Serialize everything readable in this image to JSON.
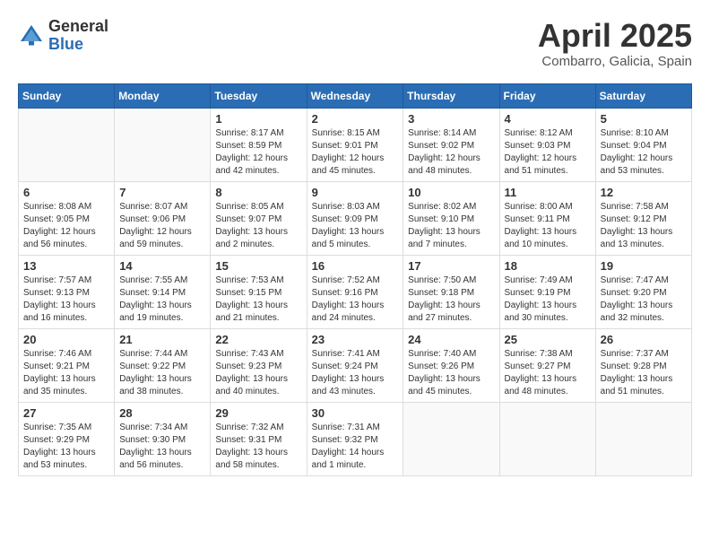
{
  "header": {
    "logo_general": "General",
    "logo_blue": "Blue",
    "month_title": "April 2025",
    "location": "Combarro, Galicia, Spain"
  },
  "weekdays": [
    "Sunday",
    "Monday",
    "Tuesday",
    "Wednesday",
    "Thursday",
    "Friday",
    "Saturday"
  ],
  "weeks": [
    [
      {
        "day": "",
        "info": ""
      },
      {
        "day": "",
        "info": ""
      },
      {
        "day": "1",
        "info": "Sunrise: 8:17 AM\nSunset: 8:59 PM\nDaylight: 12 hours and 42 minutes."
      },
      {
        "day": "2",
        "info": "Sunrise: 8:15 AM\nSunset: 9:01 PM\nDaylight: 12 hours and 45 minutes."
      },
      {
        "day": "3",
        "info": "Sunrise: 8:14 AM\nSunset: 9:02 PM\nDaylight: 12 hours and 48 minutes."
      },
      {
        "day": "4",
        "info": "Sunrise: 8:12 AM\nSunset: 9:03 PM\nDaylight: 12 hours and 51 minutes."
      },
      {
        "day": "5",
        "info": "Sunrise: 8:10 AM\nSunset: 9:04 PM\nDaylight: 12 hours and 53 minutes."
      }
    ],
    [
      {
        "day": "6",
        "info": "Sunrise: 8:08 AM\nSunset: 9:05 PM\nDaylight: 12 hours and 56 minutes."
      },
      {
        "day": "7",
        "info": "Sunrise: 8:07 AM\nSunset: 9:06 PM\nDaylight: 12 hours and 59 minutes."
      },
      {
        "day": "8",
        "info": "Sunrise: 8:05 AM\nSunset: 9:07 PM\nDaylight: 13 hours and 2 minutes."
      },
      {
        "day": "9",
        "info": "Sunrise: 8:03 AM\nSunset: 9:09 PM\nDaylight: 13 hours and 5 minutes."
      },
      {
        "day": "10",
        "info": "Sunrise: 8:02 AM\nSunset: 9:10 PM\nDaylight: 13 hours and 7 minutes."
      },
      {
        "day": "11",
        "info": "Sunrise: 8:00 AM\nSunset: 9:11 PM\nDaylight: 13 hours and 10 minutes."
      },
      {
        "day": "12",
        "info": "Sunrise: 7:58 AM\nSunset: 9:12 PM\nDaylight: 13 hours and 13 minutes."
      }
    ],
    [
      {
        "day": "13",
        "info": "Sunrise: 7:57 AM\nSunset: 9:13 PM\nDaylight: 13 hours and 16 minutes."
      },
      {
        "day": "14",
        "info": "Sunrise: 7:55 AM\nSunset: 9:14 PM\nDaylight: 13 hours and 19 minutes."
      },
      {
        "day": "15",
        "info": "Sunrise: 7:53 AM\nSunset: 9:15 PM\nDaylight: 13 hours and 21 minutes."
      },
      {
        "day": "16",
        "info": "Sunrise: 7:52 AM\nSunset: 9:16 PM\nDaylight: 13 hours and 24 minutes."
      },
      {
        "day": "17",
        "info": "Sunrise: 7:50 AM\nSunset: 9:18 PM\nDaylight: 13 hours and 27 minutes."
      },
      {
        "day": "18",
        "info": "Sunrise: 7:49 AM\nSunset: 9:19 PM\nDaylight: 13 hours and 30 minutes."
      },
      {
        "day": "19",
        "info": "Sunrise: 7:47 AM\nSunset: 9:20 PM\nDaylight: 13 hours and 32 minutes."
      }
    ],
    [
      {
        "day": "20",
        "info": "Sunrise: 7:46 AM\nSunset: 9:21 PM\nDaylight: 13 hours and 35 minutes."
      },
      {
        "day": "21",
        "info": "Sunrise: 7:44 AM\nSunset: 9:22 PM\nDaylight: 13 hours and 38 minutes."
      },
      {
        "day": "22",
        "info": "Sunrise: 7:43 AM\nSunset: 9:23 PM\nDaylight: 13 hours and 40 minutes."
      },
      {
        "day": "23",
        "info": "Sunrise: 7:41 AM\nSunset: 9:24 PM\nDaylight: 13 hours and 43 minutes."
      },
      {
        "day": "24",
        "info": "Sunrise: 7:40 AM\nSunset: 9:26 PM\nDaylight: 13 hours and 45 minutes."
      },
      {
        "day": "25",
        "info": "Sunrise: 7:38 AM\nSunset: 9:27 PM\nDaylight: 13 hours and 48 minutes."
      },
      {
        "day": "26",
        "info": "Sunrise: 7:37 AM\nSunset: 9:28 PM\nDaylight: 13 hours and 51 minutes."
      }
    ],
    [
      {
        "day": "27",
        "info": "Sunrise: 7:35 AM\nSunset: 9:29 PM\nDaylight: 13 hours and 53 minutes."
      },
      {
        "day": "28",
        "info": "Sunrise: 7:34 AM\nSunset: 9:30 PM\nDaylight: 13 hours and 56 minutes."
      },
      {
        "day": "29",
        "info": "Sunrise: 7:32 AM\nSunset: 9:31 PM\nDaylight: 13 hours and 58 minutes."
      },
      {
        "day": "30",
        "info": "Sunrise: 7:31 AM\nSunset: 9:32 PM\nDaylight: 14 hours and 1 minute."
      },
      {
        "day": "",
        "info": ""
      },
      {
        "day": "",
        "info": ""
      },
      {
        "day": "",
        "info": ""
      }
    ]
  ]
}
